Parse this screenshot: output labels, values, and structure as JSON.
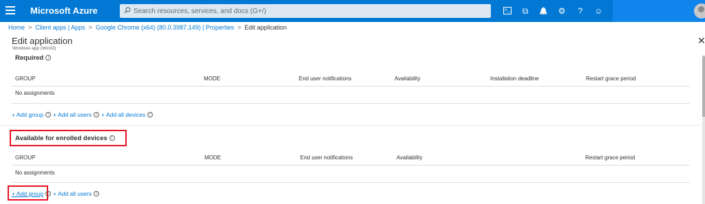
{
  "topbar": {
    "brand": "Microsoft Azure",
    "search_placeholder": "Search resources, services, and docs (G+/)",
    "icons": [
      "cloud-shell-icon",
      "directory-filter-icon",
      "notifications-icon",
      "settings-icon",
      "help-icon",
      "feedback-icon"
    ],
    "icon_glyphs": [
      ">_",
      "⧉",
      "🔔",
      "⚙",
      "?",
      "☺"
    ]
  },
  "breadcrumb": {
    "items": [
      "Home",
      "Client apps | Apps",
      "Google Chrome (x64) (80.0.3987.149) | Properties"
    ],
    "current": "Edit application",
    "separator": ">"
  },
  "page": {
    "title": "Edit application",
    "subtitle": "Windows app (Win32)",
    "close_glyph": "✕"
  },
  "required": {
    "title": "Required",
    "columns": {
      "group": "GROUP",
      "mode": "MODE",
      "notifications": "End user notifications",
      "availability": "Availability",
      "deadline": "Installation deadline",
      "restart": "Restart grace period"
    },
    "empty": "No assignments",
    "actions": {
      "add_group": "+ Add group",
      "add_all_users": "+ Add all users",
      "add_all_devices": "+ Add all devices"
    }
  },
  "available": {
    "title": "Available for enrolled devices",
    "columns": {
      "group": "GROUP",
      "mode": "MODE",
      "notifications": "End user notifications",
      "availability": "Availability",
      "restart": "Restart grace period"
    },
    "empty": "No assignments",
    "actions": {
      "add_group": "+ Add group",
      "add_all_users": "+ Add all users"
    }
  },
  "info_glyph": "i",
  "colors": {
    "accent": "#0078d4",
    "highlight": "#e81123"
  }
}
